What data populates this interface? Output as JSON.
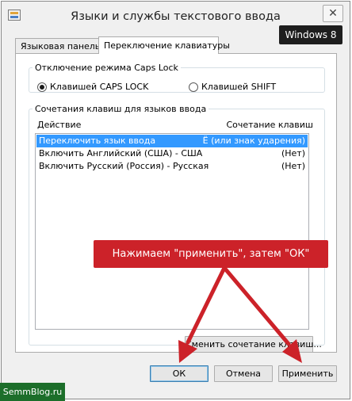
{
  "window": {
    "title": "Языки и службы текстового ввода",
    "close_glyph": "✕"
  },
  "os_label": "Windows 8",
  "tabs": [
    {
      "label": "Языковая панель",
      "active": false
    },
    {
      "label": "Переключение клавиатуры",
      "active": true
    }
  ],
  "caps_lock": {
    "legend": "Отключение режима Caps Lock",
    "options": [
      {
        "label": "Клавишей CAPS LOCK",
        "checked": true
      },
      {
        "label": "Клавишей SHIFT",
        "checked": false
      }
    ]
  },
  "hotkeys": {
    "legend": "Сочетания клавиш для языков ввода",
    "columns": {
      "action": "Действие",
      "shortcut": "Сочетание клавиш"
    },
    "rows": [
      {
        "action": "Переключить язык ввода",
        "shortcut": "Ё (или знак ударения)",
        "selected": true
      },
      {
        "action": "Включить Английский (США) - США",
        "shortcut": "(Нет)",
        "selected": false
      },
      {
        "action": "Включить Русский (Россия) - Русская",
        "shortcut": "(Нет)",
        "selected": false
      }
    ],
    "change_button": "Сменить сочетание клавиш..."
  },
  "footer": {
    "ok": "ОК",
    "cancel": "Отмена",
    "apply": "Применить"
  },
  "callout": "Нажимаем \"применить\", затем \"ОК\"",
  "watermark": "SemmBlog.ru",
  "colors": {
    "selection": "#3399ff",
    "callout_bg": "#cc2229",
    "arrow": "#cc2229",
    "watermark_bg": "#1c6e2a",
    "os_label_bg": "#1e1e1e"
  },
  "icons": {
    "app": "keyboard-settings-icon",
    "close": "close-icon"
  }
}
